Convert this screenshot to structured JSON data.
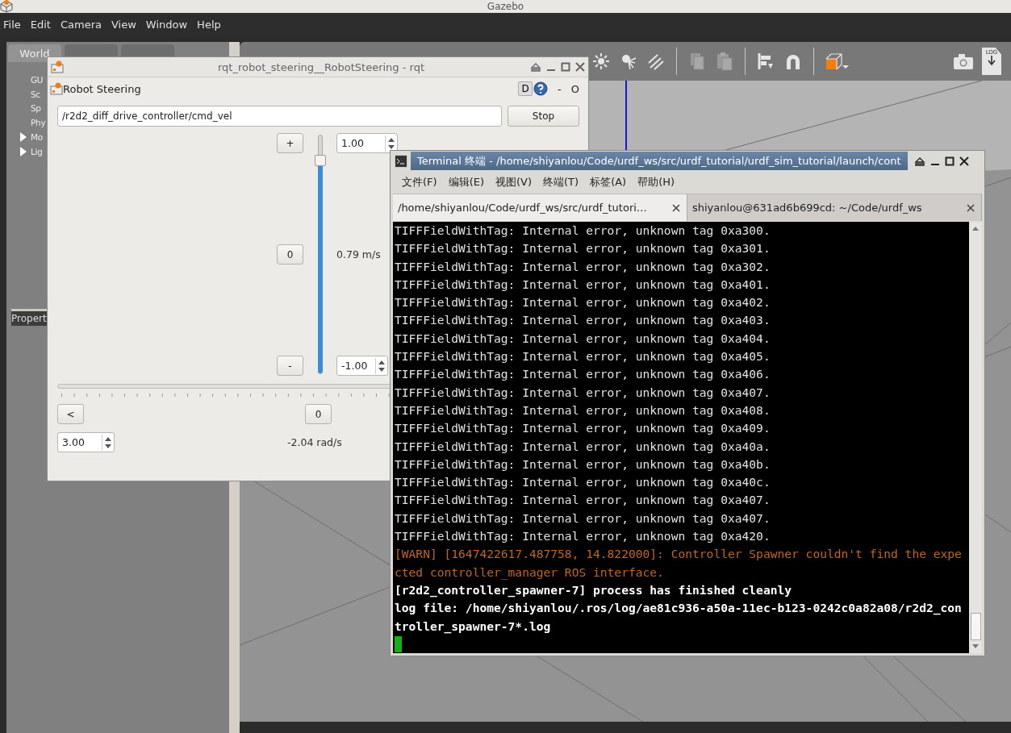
{
  "gazebo": {
    "title": "Gazebo",
    "menu": [
      "File",
      "Edit",
      "Camera",
      "View",
      "Window",
      "Help"
    ],
    "left_panel": {
      "tabs": [
        {
          "label": "World",
          "selected": true
        }
      ],
      "tree": [
        {
          "label": "GU",
          "expandable": false
        },
        {
          "label": "Sc",
          "expandable": false
        },
        {
          "label": "Sp",
          "expandable": false
        },
        {
          "label": "Phy",
          "expandable": false
        },
        {
          "label": "Mo",
          "expandable": true
        },
        {
          "label": "Lig",
          "expandable": true
        }
      ],
      "properties_label": "Propert"
    },
    "toolbar": {
      "log_label": "LOG"
    }
  },
  "rqt": {
    "title": "rqt_robot_steering__RobotSteering - rqt",
    "plugin_title": "Robot Steering",
    "dock_buttons": [
      "D"
    ],
    "dock_texts": [
      "-",
      "O"
    ],
    "topic": "/r2d2_diff_drive_controller/cmd_vel",
    "stop": "Stop",
    "linear": {
      "plus": "+",
      "zero": "0",
      "minus": "-",
      "max": "1.00",
      "min": "-1.00",
      "level": 0.895,
      "reading": "0.79 m/s"
    },
    "angular": {
      "left": "<",
      "zero": "0",
      "max": "3.00",
      "reading": "-2.04 rad/s"
    }
  },
  "terminal": {
    "title": "Terminal 终端 - /home/shiyanlou/Code/urdf_ws/src/urdf_tutorial/urdf_sim_tutorial/launch/cont",
    "menu": [
      "文件(F)",
      "编辑(E)",
      "视图(V)",
      "终端(T)",
      "标签(A)",
      "帮助(H)"
    ],
    "tabs": [
      {
        "label": "/home/shiyanlou/Code/urdf_ws/src/urdf_tutori…",
        "selected": true
      },
      {
        "label": "shiyanlou@631ad6b699cd: ~/Code/urdf_ws",
        "selected": false
      }
    ],
    "lines": [
      {
        "text": "TIFFFieldWithTag: Internal error, unknown tag 0xa300.",
        "kind": "normal"
      },
      {
        "text": "TIFFFieldWithTag: Internal error, unknown tag 0xa301.",
        "kind": "normal"
      },
      {
        "text": "TIFFFieldWithTag: Internal error, unknown tag 0xa302.",
        "kind": "normal"
      },
      {
        "text": "TIFFFieldWithTag: Internal error, unknown tag 0xa401.",
        "kind": "normal"
      },
      {
        "text": "TIFFFieldWithTag: Internal error, unknown tag 0xa402.",
        "kind": "normal"
      },
      {
        "text": "TIFFFieldWithTag: Internal error, unknown tag 0xa403.",
        "kind": "normal"
      },
      {
        "text": "TIFFFieldWithTag: Internal error, unknown tag 0xa404.",
        "kind": "normal"
      },
      {
        "text": "TIFFFieldWithTag: Internal error, unknown tag 0xa405.",
        "kind": "normal"
      },
      {
        "text": "TIFFFieldWithTag: Internal error, unknown tag 0xa406.",
        "kind": "normal"
      },
      {
        "text": "TIFFFieldWithTag: Internal error, unknown tag 0xa407.",
        "kind": "normal"
      },
      {
        "text": "TIFFFieldWithTag: Internal error, unknown tag 0xa408.",
        "kind": "normal"
      },
      {
        "text": "TIFFFieldWithTag: Internal error, unknown tag 0xa409.",
        "kind": "normal"
      },
      {
        "text": "TIFFFieldWithTag: Internal error, unknown tag 0xa40a.",
        "kind": "normal"
      },
      {
        "text": "TIFFFieldWithTag: Internal error, unknown tag 0xa40b.",
        "kind": "normal"
      },
      {
        "text": "TIFFFieldWithTag: Internal error, unknown tag 0xa40c.",
        "kind": "normal"
      },
      {
        "text": "TIFFFieldWithTag: Internal error, unknown tag 0xa407.",
        "kind": "normal"
      },
      {
        "text": "TIFFFieldWithTag: Internal error, unknown tag 0xa407.",
        "kind": "normal"
      },
      {
        "text": "TIFFFieldWithTag: Internal error, unknown tag 0xa420.",
        "kind": "normal"
      },
      {
        "text": "[WARN] [1647422617.487758, 14.822000]: Controller Spawner couldn't find the expe",
        "kind": "warn"
      },
      {
        "text": "cted controller_manager ROS interface.",
        "kind": "warn"
      },
      {
        "text": "[r2d2_controller_spawner-7] process has finished cleanly",
        "kind": "bold"
      },
      {
        "text": "log file: /home/shiyanlou/.ros/log/ae81c936-a50a-11ec-b123-0242c0a82a08/r2d2_con",
        "kind": "bold"
      },
      {
        "text": "troller_spawner-7*.log",
        "kind": "bold"
      }
    ]
  }
}
